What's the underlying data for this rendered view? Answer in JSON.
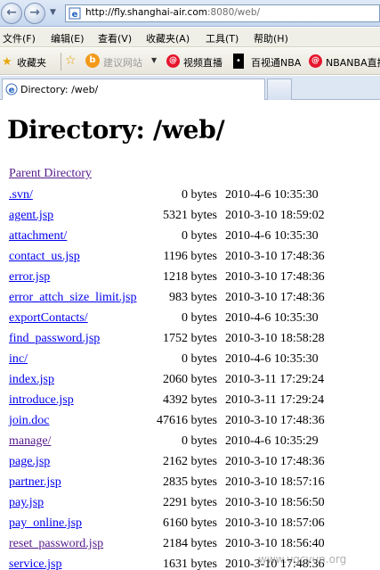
{
  "browser": {
    "url_host": "http://fly.shanghai-air.com",
    "url_rest": ":8080/web/",
    "menu": [
      "文件(F)",
      "编辑(E)",
      "查看(V)",
      "收藏夹(A)",
      "工具(T)",
      "帮助(H)"
    ],
    "favorites": {
      "label": "收藏夹",
      "suggest": "建议网站",
      "links": [
        "视频直播",
        "百视通NBA",
        "NBANBA直播"
      ]
    },
    "tab_title": "Directory: /web/"
  },
  "page": {
    "title": "Directory: /web/",
    "parent_link": "Parent Directory",
    "files": [
      {
        "name": ".svn/",
        "size": "0 bytes",
        "date": "2010-4-6 10:35:30"
      },
      {
        "name": "agent.jsp",
        "size": "5321 bytes",
        "date": "2010-3-10 18:59:02"
      },
      {
        "name": "attachment/",
        "size": "0 bytes",
        "date": "2010-4-6 10:35:30"
      },
      {
        "name": "contact_us.jsp",
        "size": "1196 bytes",
        "date": "2010-3-10 17:48:36"
      },
      {
        "name": "error.jsp",
        "size": "1218 bytes",
        "date": "2010-3-10 17:48:36"
      },
      {
        "name": "error_attch_size_limit.jsp",
        "size": "983 bytes",
        "date": "2010-3-10 17:48:36"
      },
      {
        "name": "exportContacts/",
        "size": "0 bytes",
        "date": "2010-4-6 10:35:30"
      },
      {
        "name": "find_password.jsp",
        "size": "1752 bytes",
        "date": "2010-3-10 18:58:28"
      },
      {
        "name": "inc/",
        "size": "0 bytes",
        "date": "2010-4-6 10:35:30"
      },
      {
        "name": "index.jsp",
        "size": "2060 bytes",
        "date": "2010-3-11 17:29:24"
      },
      {
        "name": "introduce.jsp",
        "size": "4392 bytes",
        "date": "2010-3-11 17:29:24"
      },
      {
        "name": "join.doc",
        "size": "47616 bytes",
        "date": "2010-3-10 17:48:36"
      },
      {
        "name": "manage/",
        "size": "0 bytes",
        "date": "2010-4-6 10:35:29"
      },
      {
        "name": "page.jsp",
        "size": "2162 bytes",
        "date": "2010-3-10 17:48:36"
      },
      {
        "name": "partner.jsp",
        "size": "2835 bytes",
        "date": "2010-3-10 18:57:16"
      },
      {
        "name": "pay.jsp",
        "size": "2291 bytes",
        "date": "2010-3-10 18:56:50"
      },
      {
        "name": "pay_online.jsp",
        "size": "6160 bytes",
        "date": "2010-3-10 18:57:06"
      },
      {
        "name": "reset_password.jsp",
        "size": "2184 bytes",
        "date": "2010-3-10 18:56:40"
      },
      {
        "name": "service.jsp",
        "size": "1631 bytes",
        "date": "2010-3-10 17:48:36"
      }
    ]
  },
  "watermark": "www.vgcyun.org",
  "colors": {
    "link": "#0000ee",
    "visited": "#551a8b"
  }
}
